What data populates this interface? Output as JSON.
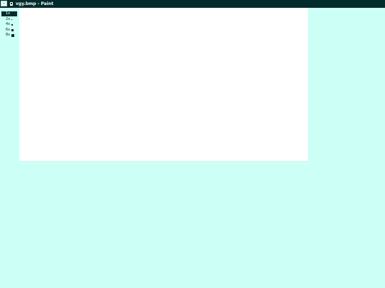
{
  "window": {
    "title": "vgy.bmp - Paint",
    "system_menu_icon": "menu-icon",
    "app_icon": "paint-document-icon"
  },
  "brush_sizes": {
    "selected": "1x",
    "items": [
      {
        "label": "1x",
        "icon": "brush-1x-icon"
      },
      {
        "label": "2x",
        "icon": "brush-2x-icon"
      },
      {
        "label": "4x",
        "icon": "brush-4x-icon"
      },
      {
        "label": "6x",
        "icon": "brush-6x-icon"
      },
      {
        "label": "8x",
        "icon": "brush-8x-icon"
      }
    ]
  },
  "colors": {
    "background": "#ccfff5",
    "titlebar": "#022b2b",
    "canvas": "#ffffff"
  }
}
